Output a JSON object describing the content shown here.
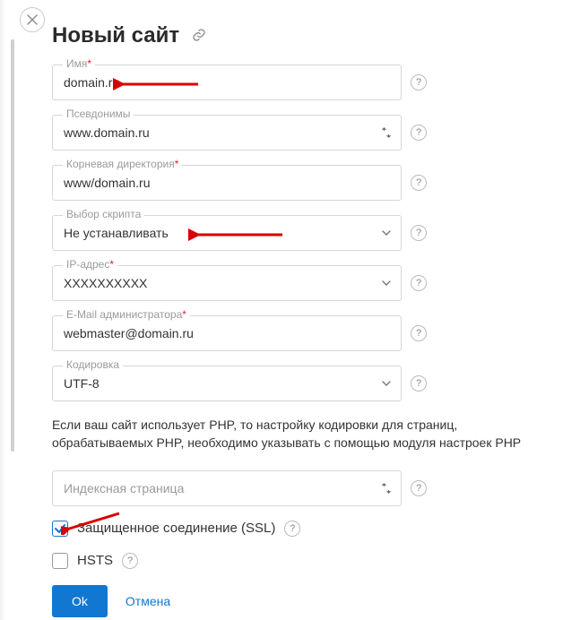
{
  "header": {
    "title": "Новый сайт"
  },
  "fields": {
    "name": {
      "label": "Имя",
      "value": "domain.ru",
      "required": true
    },
    "aliases": {
      "label": "Псевдонимы",
      "value": "www.domain.ru",
      "required": false
    },
    "root": {
      "label": "Корневая директория",
      "value": "www/domain.ru",
      "required": true
    },
    "script": {
      "label": "Выбор скрипта",
      "value": "Не устанавливать",
      "required": false
    },
    "ip": {
      "label": "IP-адрес",
      "value": "XXXXXXXXXX",
      "required": true
    },
    "email": {
      "label": "E-Mail администратора",
      "value": "webmaster@domain.ru",
      "required": true
    },
    "charset": {
      "label": "Кодировка",
      "value": "UTF-8",
      "required": false
    },
    "index": {
      "label": "",
      "placeholder": "Индексная страница",
      "required": false
    }
  },
  "info_text": "Если ваш сайт использует PHP, то настройку кодировки для страниц, обрабатываемых PHP, необходимо указывать с помощью модуля настроек PHP",
  "checkboxes": {
    "ssl": {
      "label": "Защищенное соединение (SSL)",
      "checked": true
    },
    "hsts": {
      "label": "HSTS",
      "checked": false
    }
  },
  "buttons": {
    "ok": "Ok",
    "cancel": "Отмена"
  }
}
